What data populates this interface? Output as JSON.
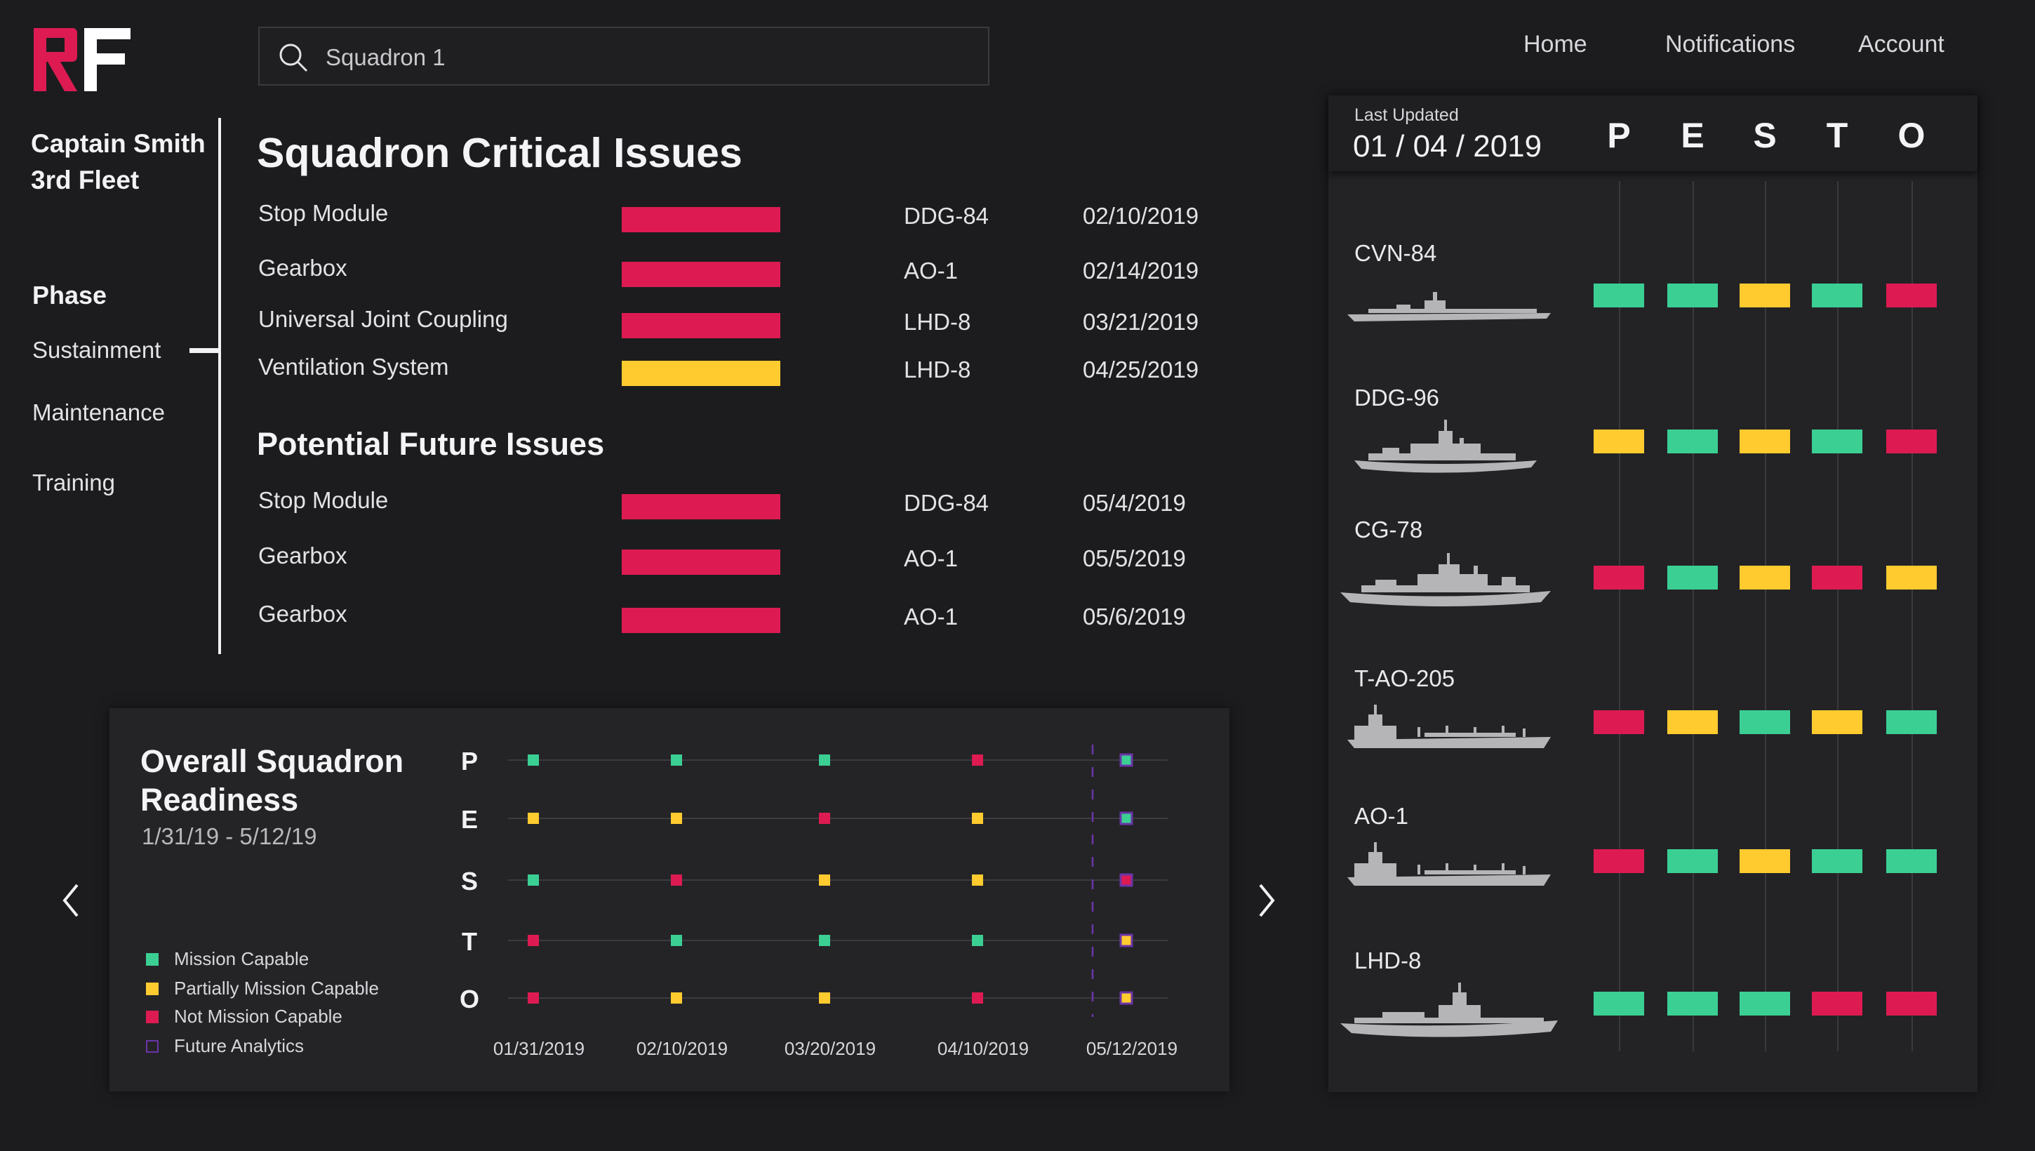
{
  "app": {
    "brand_letters": "RF"
  },
  "search": {
    "value": "Squadron 1"
  },
  "nav": {
    "home": "Home",
    "notifications": "Notifications",
    "account": "Account"
  },
  "user": {
    "name": "Captain Smith",
    "fleet": "3rd Fleet"
  },
  "phase": {
    "heading": "Phase",
    "items": [
      "Sustainment",
      "Maintenance",
      "Training"
    ],
    "selected": "Sustainment"
  },
  "colors": {
    "mission_capable": "#3bcf94",
    "partially_capable": "#ffcb2f",
    "not_capable": "#dd1b52",
    "future": "#6b35a8"
  },
  "critical": {
    "title": "Squadron Critical Issues",
    "rows": [
      {
        "name": "Stop Module",
        "status": "not_capable",
        "ship": "DDG-84",
        "date": "02/10/2019"
      },
      {
        "name": "Gearbox",
        "status": "not_capable",
        "ship": "AO-1",
        "date": "02/14/2019"
      },
      {
        "name": "Universal Joint Coupling",
        "status": "not_capable",
        "ship": "LHD-8",
        "date": "03/21/2019"
      },
      {
        "name": "Ventilation System",
        "status": "partially_capable",
        "ship": "LHD-8",
        "date": "04/25/2019"
      }
    ]
  },
  "future": {
    "title": "Potential Future Issues",
    "rows": [
      {
        "name": "Stop Module",
        "status": "not_capable",
        "ship": "DDG-84",
        "date": "05/4/2019"
      },
      {
        "name": "Gearbox",
        "status": "not_capable",
        "ship": "AO-1",
        "date": "05/5/2019"
      },
      {
        "name": "Gearbox",
        "status": "not_capable",
        "ship": "AO-1",
        "date": "05/6/2019"
      }
    ]
  },
  "readiness": {
    "title_line1": "Overall Squadron",
    "title_line2": "Readiness",
    "range": "1/31/19 - 5/12/19",
    "legend": {
      "mission_capable": "Mission Capable",
      "partially_capable": "Partially Mission Capable",
      "not_capable": "Not Mission Capable",
      "future": "Future Analytics"
    }
  },
  "chart_data": {
    "type": "scatter",
    "categories": [
      "01/31/2019",
      "02/10/2019",
      "03/20/2019",
      "04/10/2019",
      "05/12/2019"
    ],
    "rows": [
      "P",
      "E",
      "S",
      "T",
      "O"
    ],
    "future_from": "05/12/2019",
    "grid": true,
    "series": [
      {
        "row": "P",
        "values": [
          "mission_capable",
          "mission_capable",
          "mission_capable",
          "not_capable",
          "mission_capable"
        ]
      },
      {
        "row": "E",
        "values": [
          "partially_capable",
          "partially_capable",
          "not_capable",
          "partially_capable",
          "mission_capable"
        ]
      },
      {
        "row": "S",
        "values": [
          "mission_capable",
          "not_capable",
          "partially_capable",
          "partially_capable",
          "not_capable"
        ]
      },
      {
        "row": "T",
        "values": [
          "not_capable",
          "mission_capable",
          "mission_capable",
          "mission_capable",
          "partially_capable"
        ]
      },
      {
        "row": "O",
        "values": [
          "not_capable",
          "partially_capable",
          "partially_capable",
          "not_capable",
          "partially_capable"
        ]
      }
    ]
  },
  "status_panel": {
    "last_updated_label": "Last Updated",
    "last_updated": "01 / 04 / 2019",
    "columns": [
      "P",
      "E",
      "S",
      "T",
      "O"
    ],
    "ships": [
      {
        "name": "CVN-84",
        "icon": "aircraft-carrier-icon",
        "status": [
          "mission_capable",
          "mission_capable",
          "partially_capable",
          "mission_capable",
          "not_capable"
        ]
      },
      {
        "name": "DDG-96",
        "icon": "destroyer-icon",
        "status": [
          "partially_capable",
          "mission_capable",
          "partially_capable",
          "mission_capable",
          "not_capable"
        ]
      },
      {
        "name": "CG-78",
        "icon": "cruiser-icon",
        "status": [
          "not_capable",
          "mission_capable",
          "partially_capable",
          "not_capable",
          "partially_capable"
        ]
      },
      {
        "name": "T-AO-205",
        "icon": "oiler-icon",
        "status": [
          "not_capable",
          "partially_capable",
          "mission_capable",
          "partially_capable",
          "mission_capable"
        ]
      },
      {
        "name": "AO-1",
        "icon": "oiler-icon",
        "status": [
          "not_capable",
          "mission_capable",
          "partially_capable",
          "mission_capable",
          "mission_capable"
        ]
      },
      {
        "name": "LHD-8",
        "icon": "amphibious-assault-ship-icon",
        "status": [
          "mission_capable",
          "mission_capable",
          "mission_capable",
          "not_capable",
          "not_capable"
        ]
      }
    ]
  }
}
